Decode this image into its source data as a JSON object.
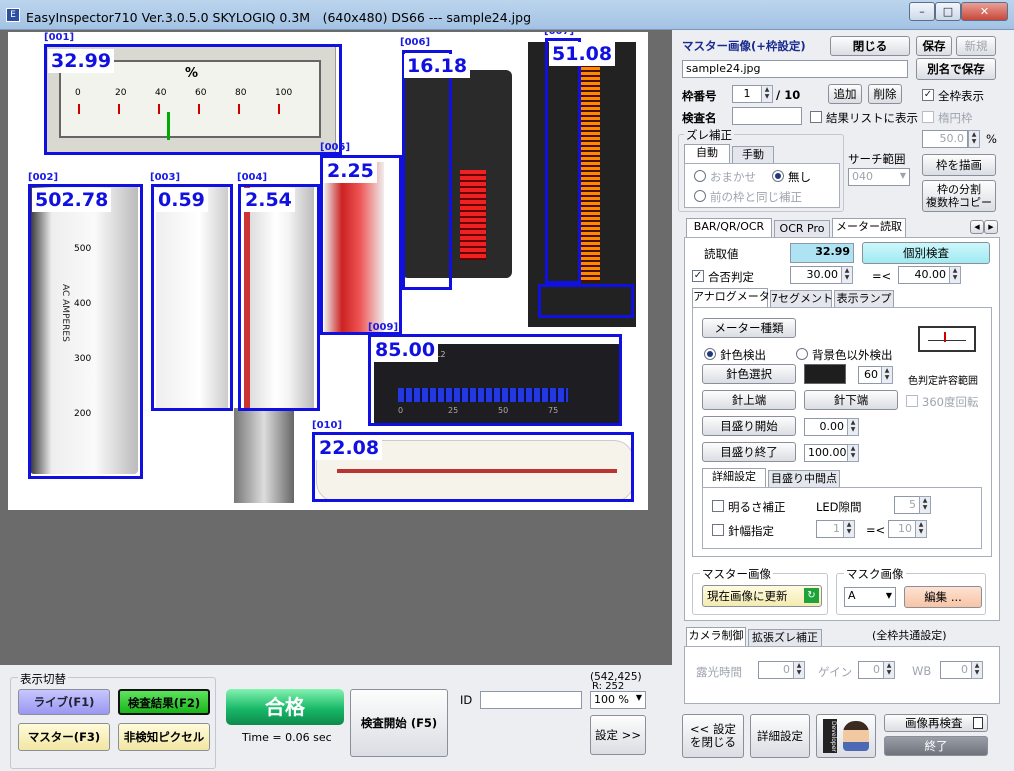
{
  "window": {
    "title": "EasyInspector710 Ver.3.0.5.0 SKYLOGIQ 0.3M　(640x480) DS66 --- sample24.jpg",
    "min": "–",
    "max": "□",
    "close": "✕"
  },
  "rois": [
    {
      "id": "[001]",
      "value": "32.99"
    },
    {
      "id": "[002]",
      "value": "502.78"
    },
    {
      "id": "[003]",
      "value": "0.59"
    },
    {
      "id": "[004]",
      "value": "2.54"
    },
    {
      "id": "[005]",
      "value": "2.25"
    },
    {
      "id": "[006]",
      "value": "16.18"
    },
    {
      "id": "[007]",
      "value": "51.08"
    },
    {
      "id": "[008]",
      "value": ""
    },
    {
      "id": "[009]",
      "value": "85.00"
    },
    {
      "id": "[010]",
      "value": "22.08"
    }
  ],
  "meter": {
    "pct": "%",
    "ticks": [
      "0",
      "20",
      "40",
      "60",
      "80",
      "100"
    ],
    "current": 32.99
  },
  "bargraph": {
    "ticks": [
      "0",
      "25",
      "50",
      "75"
    ],
    "l1": "L1",
    "l2": "L2",
    "level": 85
  },
  "bottom": {
    "display_switch": "表示切替",
    "live": "ライブ(F1)",
    "result": "検査結果(F2)",
    "master": "マスター(F3)",
    "undetected": "非検知ピクセル",
    "pass": "合格",
    "time": "Time = 0.06 sec",
    "start": "検査開始 (F5)",
    "id_label": "ID",
    "id_value": "",
    "coords": "(542,425)",
    "rgb_line": "R: 252",
    "zoom": "100 %",
    "settings": "設定 >>"
  },
  "right": {
    "master_title": "マスター画像(+枠設定)",
    "close": "閉じる",
    "save": "保存",
    "new": "新規",
    "filename": "sample24.jpg",
    "save_as": "別名で保存",
    "frame_no_label": "枠番号",
    "frame_no": "1",
    "frame_total": "/ 10",
    "add": "追加",
    "delete": "削除",
    "all_frames": "全枠表示",
    "inspect_name_label": "検査名",
    "inspect_name": "",
    "result_list": "結果リストに表示",
    "ellipse": "楕円枠",
    "angle": "50.0",
    "angle_unit": "%",
    "shift_title": "ズレ補正",
    "tab_auto": "自動",
    "tab_manual": "手動",
    "omakase": "おまかせ",
    "none": "無し",
    "same_as_prev": "前の枠と同じ補正",
    "search_label": "サーチ範囲",
    "search_value": "040",
    "draw_frame": "枠を描画",
    "split_copy": "枠の分割\n複数枠コピー",
    "tabs": [
      "BAR/QR/OCR",
      "OCR Pro",
      "メーター読取"
    ],
    "read_label": "読取値",
    "read_value": "32.99",
    "single_inspect": "個別検査",
    "judge": "合否判定",
    "judge_min": "30.00",
    "le": "=<",
    "judge_max": "40.00",
    "sub_tabs": [
      "アナログメータ",
      "7セグメント",
      "表示ランプ"
    ],
    "meter_type": "メーター種類",
    "needle_detect": "針色検出",
    "bg_detect": "背景色以外検出",
    "needle_color": "針色選択",
    "color_tol": "60",
    "color_tol_label": "色判定許容範囲",
    "needle_top": "針上端",
    "needle_bottom": "針下端",
    "rot360": "360度回転",
    "scale_start": "目盛り開始",
    "scale_start_val": "0.00",
    "scale_end": "目盛り終了",
    "scale_end_val": "100.00",
    "detail_tab": "詳細設定",
    "mid_tab": "目盛り中間点",
    "brightness": "明るさ補正",
    "led_gap": "LED隙間",
    "led_gap_val": "5",
    "needle_width": "針幅指定",
    "nw_min": "1",
    "nw_max": "10",
    "master_img": "マスター画像",
    "update_current": "現在画像に更新",
    "mask_img": "マスク画像",
    "mask_val": "A",
    "edit": "編集 ...",
    "cam_tab": "カメラ制御",
    "ext_tab": "拡張ズレ補正",
    "common": "(全枠共通設定)",
    "exposure": "露光時間",
    "exposure_val": "0",
    "gain": "ゲイン",
    "gain_val": "0",
    "wb": "WB",
    "wb_val": "0",
    "close_settings": "<< 設定\nを閉じる",
    "detail_settings": "詳細設定",
    "reinspect": "画像再検査",
    "exit": "終了"
  }
}
